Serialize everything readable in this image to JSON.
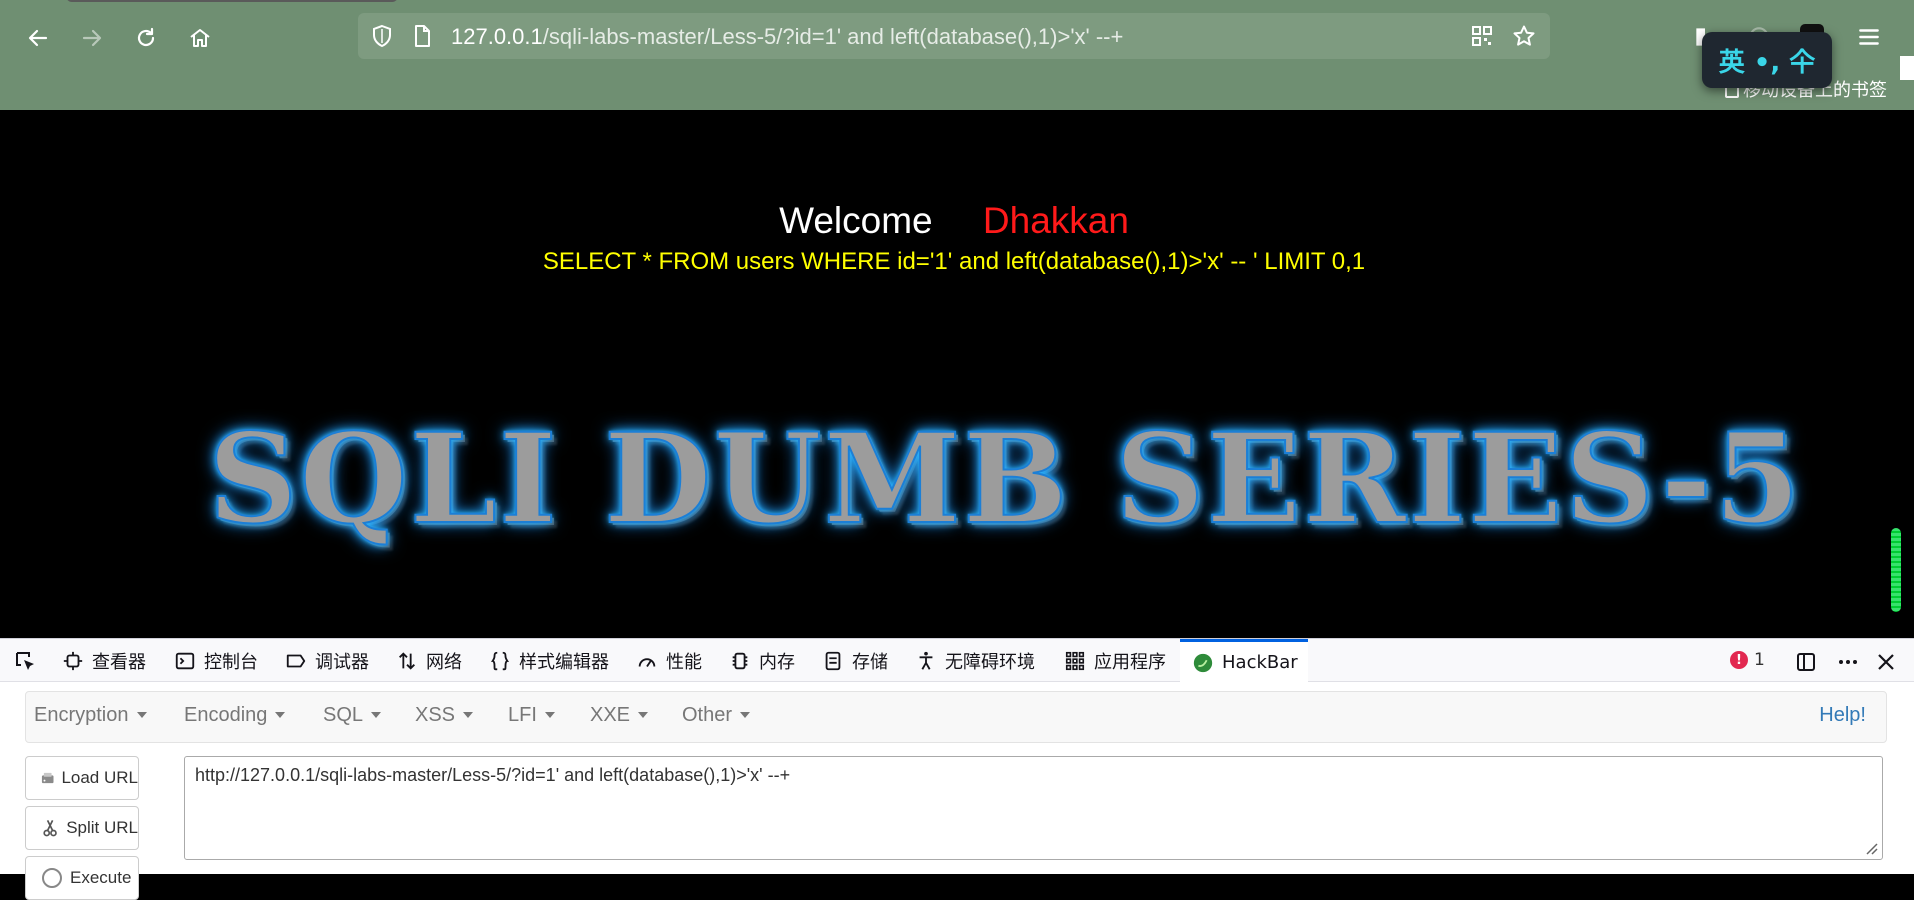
{
  "browser": {
    "url_host": "127.0.0.1",
    "url_path": "/sqli-labs-master/Less-5/?id=1' and left(database(),1)>'x' --+",
    "bookmarks_label": "移动设备上的书签",
    "ime_text": "英 •, 仐"
  },
  "page": {
    "welcome": "Welcome",
    "name": "Dhakkan",
    "query": "SELECT * FROM users WHERE id='1' and left(database(),1)>'x' -- ' LIMIT 0,1",
    "banner": "SQLI DUMB SERIES-5"
  },
  "devtools": {
    "tabs": [
      {
        "label": "查看器",
        "icon": "inspector-icon"
      },
      {
        "label": "控制台",
        "icon": "console-icon"
      },
      {
        "label": "调试器",
        "icon": "debugger-icon"
      },
      {
        "label": "网络",
        "icon": "network-icon"
      },
      {
        "label": "样式编辑器",
        "icon": "style-editor-icon"
      },
      {
        "label": "性能",
        "icon": "performance-icon"
      },
      {
        "label": "内存",
        "icon": "memory-icon"
      },
      {
        "label": "存储",
        "icon": "storage-icon"
      },
      {
        "label": "无障碍环境",
        "icon": "accessibility-icon"
      },
      {
        "label": "应用程序",
        "icon": "application-icon"
      },
      {
        "label": "HackBar",
        "icon": "hackbar-icon"
      }
    ],
    "active_tab": "HackBar",
    "error_count": "1"
  },
  "hackbar": {
    "menu": [
      "Encryption",
      "Encoding",
      "SQL",
      "XSS",
      "LFI",
      "XXE",
      "Other"
    ],
    "help": "Help!",
    "load_url": "Load URL",
    "split_url": "Split URL",
    "execute": "Execute",
    "url_value": "http://127.0.0.1/sqli-labs-master/Less-5/?id=1' and left(database(),1)>'x' --+"
  },
  "colors": {
    "chrome_bg": "#6f8f72",
    "welcome": "#ffffff",
    "name": "#ff1a1a",
    "query": "#ffff00",
    "active_tab_accent": "#0061e0"
  }
}
